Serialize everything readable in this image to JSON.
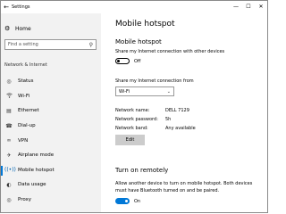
{
  "titlebar": {
    "title": "Settings",
    "back_icon": "back-arrow-icon",
    "minimize": "—",
    "maximize": "☐",
    "close": "✕"
  },
  "sidebar": {
    "home_label": "Home",
    "search_placeholder": "Find a setting",
    "section_header": "Network & Internet",
    "items": [
      {
        "label": "Status",
        "icon": "globe-icon"
      },
      {
        "label": "Wi-Fi",
        "icon": "wifi-icon"
      },
      {
        "label": "Ethernet",
        "icon": "ethernet-icon"
      },
      {
        "label": "Dial-up",
        "icon": "phone-icon"
      },
      {
        "label": "VPN",
        "icon": "vpn-icon"
      },
      {
        "label": "Airplane mode",
        "icon": "airplane-icon"
      },
      {
        "label": "Mobile hotspot",
        "icon": "hotspot-icon",
        "active": true
      },
      {
        "label": "Data usage",
        "icon": "data-usage-icon"
      },
      {
        "label": "Proxy",
        "icon": "globe-icon"
      }
    ],
    "accent_color": "#0078d7"
  },
  "main": {
    "page_title": "Mobile hotspot",
    "hotspot": {
      "heading": "Mobile hotspot",
      "description": "Share my Internet connection with other devices",
      "toggle_state": "Off"
    },
    "share_from": {
      "label": "Share my Internet connection from",
      "selected": "Wi-Fi"
    },
    "network": {
      "name_label": "Network name:",
      "name_value": "DELL 7129",
      "password_label": "Network password:",
      "password_value": "5h",
      "band_label": "Network band:",
      "band_value": "Any available"
    },
    "edit_label": "Edit",
    "remote": {
      "heading": "Turn on remotely",
      "description_line1": "Allow another device to turn on mobile hotspot. Both devices",
      "description_line2": "must have Bluetooth turned on and be paired.",
      "toggle_state": "On"
    }
  }
}
